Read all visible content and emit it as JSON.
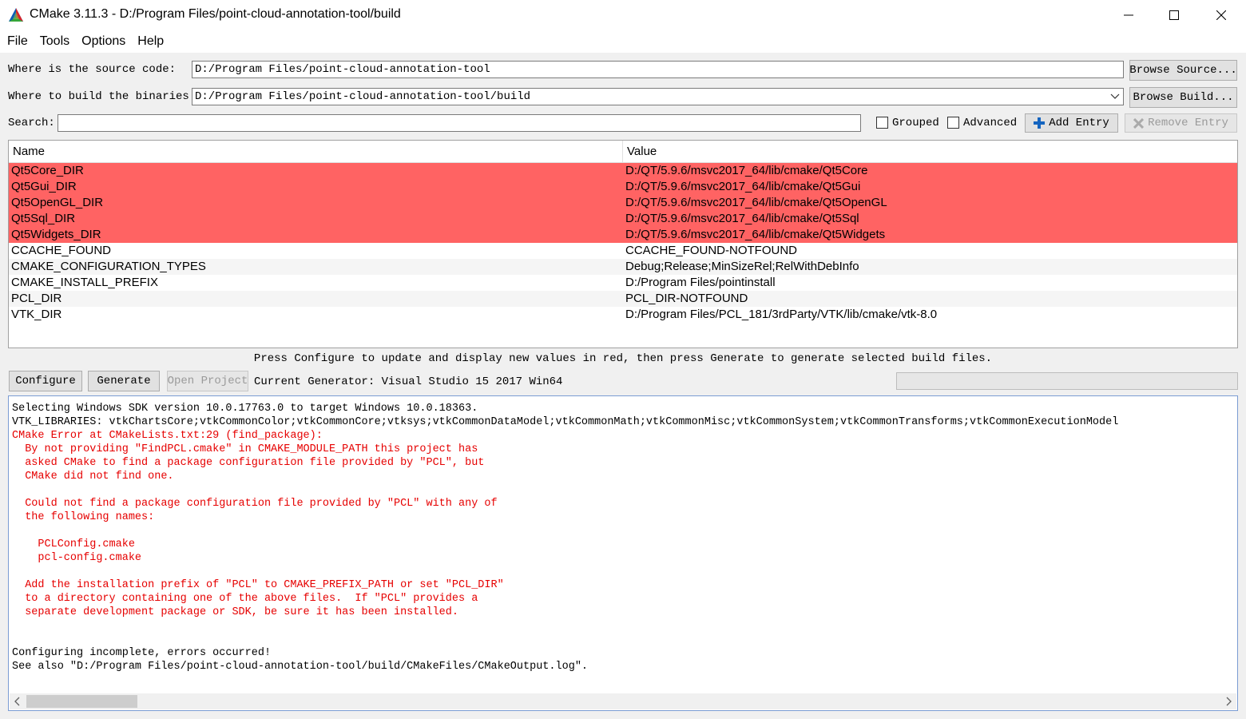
{
  "window": {
    "title": "CMake 3.11.3 - D:/Program Files/point-cloud-annotation-tool/build",
    "icon": "cmake-triangle-icon"
  },
  "menu": [
    {
      "label": "File"
    },
    {
      "label": "Tools"
    },
    {
      "label": "Options"
    },
    {
      "label": "Help"
    }
  ],
  "source": {
    "label": "Where is the source code:",
    "value": "D:/Program Files/point-cloud-annotation-tool",
    "button": "Browse Source..."
  },
  "build": {
    "label": "Where to build the binaries:",
    "value": "D:/Program Files/point-cloud-annotation-tool/build",
    "button": "Browse Build..."
  },
  "search": {
    "label": "Search:",
    "value": "",
    "grouped": {
      "label": "Grouped",
      "checked": false
    },
    "advanced": {
      "label": "Advanced",
      "checked": false
    },
    "add_entry": "Add Entry",
    "remove_entry": "Remove Entry"
  },
  "table": {
    "headers": [
      "Name",
      "Value"
    ],
    "rows": [
      {
        "name": "Qt5Core_DIR",
        "value": "D:/QT/5.9.6/msvc2017_64/lib/cmake/Qt5Core",
        "new": true
      },
      {
        "name": "Qt5Gui_DIR",
        "value": "D:/QT/5.9.6/msvc2017_64/lib/cmake/Qt5Gui",
        "new": true
      },
      {
        "name": "Qt5OpenGL_DIR",
        "value": "D:/QT/5.9.6/msvc2017_64/lib/cmake/Qt5OpenGL",
        "new": true
      },
      {
        "name": "Qt5Sql_DIR",
        "value": "D:/QT/5.9.6/msvc2017_64/lib/cmake/Qt5Sql",
        "new": true
      },
      {
        "name": "Qt5Widgets_DIR",
        "value": "D:/QT/5.9.6/msvc2017_64/lib/cmake/Qt5Widgets",
        "new": true
      },
      {
        "name": "CCACHE_FOUND",
        "value": "CCACHE_FOUND-NOTFOUND",
        "new": false
      },
      {
        "name": "CMAKE_CONFIGURATION_TYPES",
        "value": "Debug;Release;MinSizeRel;RelWithDebInfo",
        "new": false
      },
      {
        "name": "CMAKE_INSTALL_PREFIX",
        "value": "D:/Program Files/pointinstall",
        "new": false
      },
      {
        "name": "PCL_DIR",
        "value": "PCL_DIR-NOTFOUND",
        "new": false
      },
      {
        "name": "VTK_DIR",
        "value": "D:/Program Files/PCL_181/3rdParty/VTK/lib/cmake/vtk-8.0",
        "new": false
      }
    ],
    "new_row_color": "#ff6363"
  },
  "hint": "Press Configure to update and display new values in red, then press Generate to generate selected build files.",
  "actions": {
    "configure": "Configure",
    "generate": "Generate",
    "open_project": "Open Project",
    "current_generator": "Current Generator: Visual Studio 15 2017 Win64"
  },
  "output": {
    "lines": [
      {
        "text": "Selecting Windows SDK version 10.0.17763.0 to target Windows 10.0.18363.",
        "error": false
      },
      {
        "text": "VTK_LIBRARIES: vtkChartsCore;vtkCommonColor;vtkCommonCore;vtksys;vtkCommonDataModel;vtkCommonMath;vtkCommonMisc;vtkCommonSystem;vtkCommonTransforms;vtkCommonExecutionModel",
        "error": false
      },
      {
        "text": "CMake Error at CMakeLists.txt:29 (find_package):",
        "error": true
      },
      {
        "text": "  By not providing \"FindPCL.cmake\" in CMAKE_MODULE_PATH this project has",
        "error": true
      },
      {
        "text": "  asked CMake to find a package configuration file provided by \"PCL\", but",
        "error": true
      },
      {
        "text": "  CMake did not find one.",
        "error": true
      },
      {
        "text": "",
        "error": true
      },
      {
        "text": "  Could not find a package configuration file provided by \"PCL\" with any of",
        "error": true
      },
      {
        "text": "  the following names:",
        "error": true
      },
      {
        "text": "",
        "error": true
      },
      {
        "text": "    PCLConfig.cmake",
        "error": true
      },
      {
        "text": "    pcl-config.cmake",
        "error": true
      },
      {
        "text": "",
        "error": true
      },
      {
        "text": "  Add the installation prefix of \"PCL\" to CMAKE_PREFIX_PATH or set \"PCL_DIR\"",
        "error": true
      },
      {
        "text": "  to a directory containing one of the above files.  If \"PCL\" provides a",
        "error": true
      },
      {
        "text": "  separate development package or SDK, be sure it has been installed.",
        "error": true
      },
      {
        "text": "",
        "error": false
      },
      {
        "text": "",
        "error": false
      },
      {
        "text": "Configuring incomplete, errors occurred!",
        "error": false
      },
      {
        "text": "See also \"D:/Program Files/point-cloud-annotation-tool/build/CMakeFiles/CMakeOutput.log\".",
        "error": false
      }
    ],
    "error_color": "#e60000"
  }
}
